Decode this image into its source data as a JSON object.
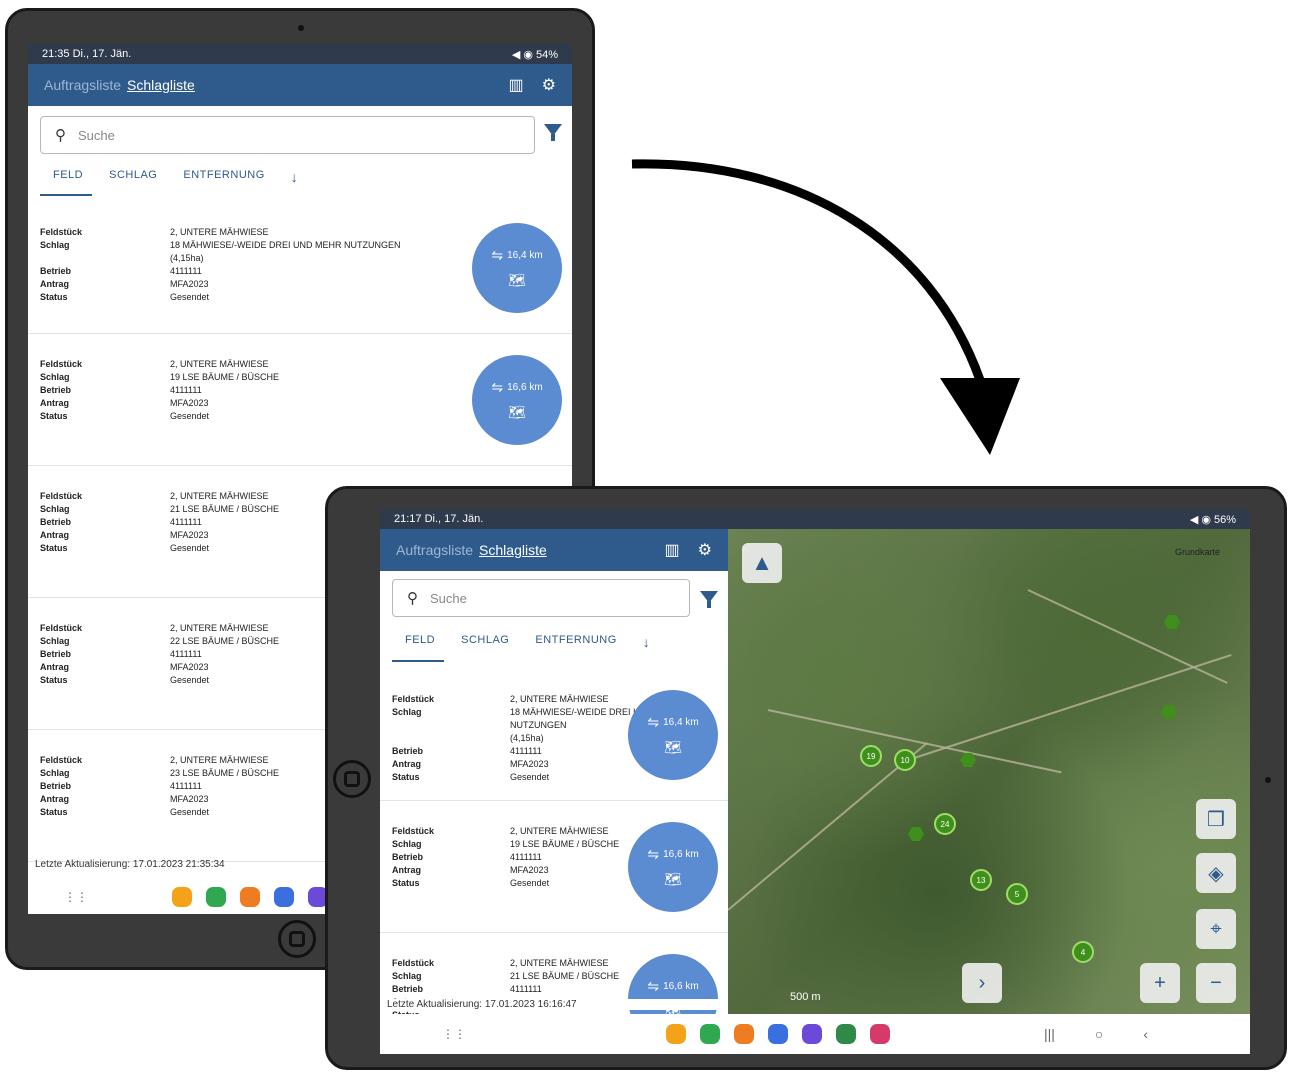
{
  "left_tablet": {
    "status": {
      "time": "21:35 Di., 17. Jän.",
      "right": "◀ ◉ 54%"
    },
    "appbar": {
      "nav_inactive": "Auftragsliste",
      "nav_active": "Schlagliste"
    },
    "search_placeholder": "Suche",
    "tabs": [
      "FELD",
      "SCHLAG",
      "ENTFERNUNG"
    ],
    "items": [
      {
        "feldstueck": "2, UNTERE MÄHWIESE",
        "schlag": "18  MÄHWIESE/-WEIDE DREI UND MEHR NUTZUNGEN",
        "schlag_extra": "(4,15ha)",
        "betrieb": "4111111",
        "antrag": "MFA2023",
        "status": "Gesendet",
        "distance": "16,4 km"
      },
      {
        "feldstueck": "2, UNTERE MÄHWIESE",
        "schlag": "19  LSE BÄUME / BÜSCHE",
        "schlag_extra": "",
        "betrieb": "4111111",
        "antrag": "MFA2023",
        "status": "Gesendet",
        "distance": "16,6 km"
      },
      {
        "feldstueck": "2, UNTERE MÄHWIESE",
        "schlag": "21  LSE BÄUME / BÜSCHE",
        "schlag_extra": "",
        "betrieb": "4111111",
        "antrag": "MFA2023",
        "status": "Gesendet",
        "distance": ""
      },
      {
        "feldstueck": "2, UNTERE MÄHWIESE",
        "schlag": "22  LSE BÄUME / BÜSCHE",
        "schlag_extra": "",
        "betrieb": "4111111",
        "antrag": "MFA2023",
        "status": "Gesendet",
        "distance": ""
      },
      {
        "feldstueck": "2, UNTERE MÄHWIESE",
        "schlag": "23  LSE BÄUME / BÜSCHE",
        "schlag_extra": "",
        "betrieb": "4111111",
        "antrag": "MFA2023",
        "status": "Gesendet",
        "distance": ""
      }
    ],
    "last_update": "Letzte Aktualisierung: 17.01.2023 21:35:34"
  },
  "right_tablet": {
    "status": {
      "time": "21:17 Di., 17. Jän.",
      "right": "◀ ◉ 56%"
    },
    "appbar": {
      "nav_inactive": "Auftragsliste",
      "nav_active": "Schlagliste"
    },
    "search_placeholder": "Suche",
    "tabs": [
      "FELD",
      "SCHLAG",
      "ENTFERNUNG"
    ],
    "items": [
      {
        "feldstueck": "2, UNTERE MÄHWIESE",
        "schlag": "18  MÄHWIESE/-WEIDE DREI UND MEHR NUTZUNGEN",
        "schlag_extra": "(4,15ha)",
        "betrieb": "4111111",
        "antrag": "MFA2023",
        "status": "Gesendet",
        "distance": "16,4 km"
      },
      {
        "feldstueck": "2, UNTERE MÄHWIESE",
        "schlag": "19  LSE BÄUME / BÜSCHE",
        "schlag_extra": "",
        "betrieb": "4111111",
        "antrag": "MFA2023",
        "status": "Gesendet",
        "distance": "16,6 km"
      },
      {
        "feldstueck": "2, UNTERE MÄHWIESE",
        "schlag": "21  LSE BÄUME / BÜSCHE",
        "schlag_extra": "",
        "betrieb": "4111111",
        "antrag": "",
        "status": "",
        "distance": "16,6 km"
      }
    ],
    "last_update": "Letzte Aktualisierung: 17.01.2023 16:16:47",
    "map": {
      "layer_label": "Grundkarte",
      "scale": "500 m",
      "clusters": [
        "19",
        "10",
        "24",
        "13",
        "5",
        "4"
      ]
    }
  },
  "labels": {
    "feldstueck": "Feldstück",
    "schlag": "Schlag",
    "betrieb": "Betrieb",
    "antrag": "Antrag",
    "status": "Status"
  }
}
